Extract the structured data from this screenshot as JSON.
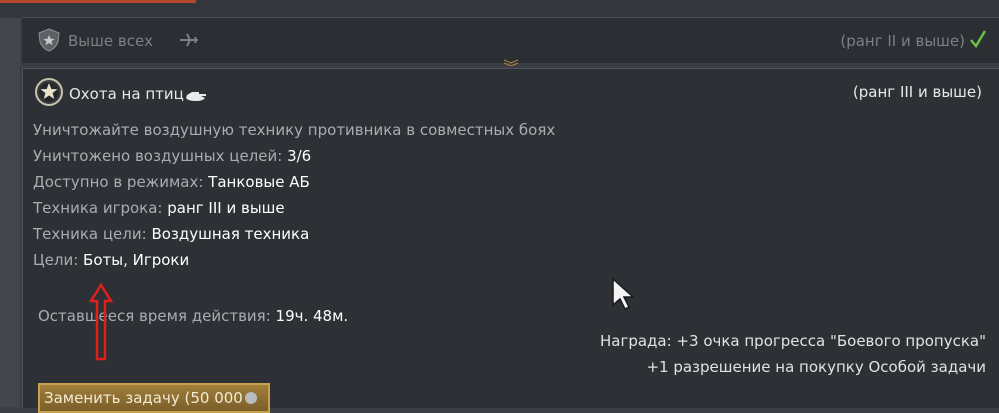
{
  "previous_task": {
    "title": "Выше всех",
    "rank": "(ранг II и выше)",
    "badge_icon": "star-shield-icon",
    "vehicle_icon": "plane-icon",
    "completed_icon": "checkmark-icon"
  },
  "task": {
    "title": "Охота на птиц",
    "rank": "(ранг III и выше)",
    "badge_icon": "star-badge-icon",
    "vehicle_icon": "tank-icon",
    "description": "Уничтожайте воздушную технику противника в совместных боях",
    "fields": [
      {
        "label": "Уничтожено воздушных целей:",
        "value": "3/6"
      },
      {
        "label": "Доступно в режимах:",
        "value": "Танковые АБ"
      },
      {
        "label": "Техника игрока:",
        "value": "ранг III и выше"
      },
      {
        "label": "Техника цели:",
        "value": "Воздушная техника"
      },
      {
        "label": "Цели:",
        "value": "Боты, Игроки"
      }
    ],
    "time_left": {
      "label": "Оставшееся время действия:",
      "value": "19ч. 48м."
    },
    "reward": {
      "line1": "Награда: +3 очка прогресса \"Боевого пропуска\"",
      "line2": "+1 разрешение на покупку Особой задачи"
    },
    "replace_button": {
      "label": "Заменить задачу (50 000",
      "currency_icon": "silver-lion-coin-icon"
    }
  },
  "colors": {
    "accent": "#b8452e",
    "check": "#6cc04a",
    "annotation_arrow": "#e0201a",
    "button_gold": "#c9a04e"
  }
}
